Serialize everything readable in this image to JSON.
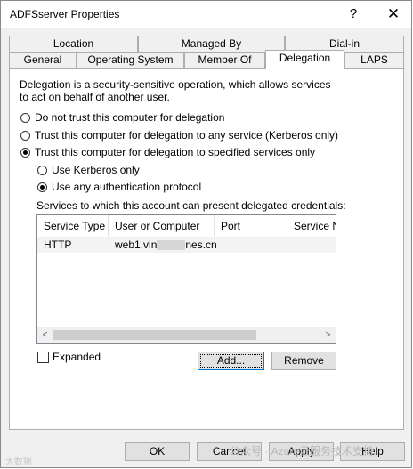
{
  "window": {
    "title": "ADFSserver Properties",
    "help_glyph": "?",
    "close_glyph": "✕"
  },
  "tabs_back": [
    {
      "label": "Location"
    },
    {
      "label": "Managed By"
    },
    {
      "label": "Dial-in"
    }
  ],
  "tabs_front": [
    {
      "label": "General"
    },
    {
      "label": "Operating System"
    },
    {
      "label": "Member Of"
    },
    {
      "label": "Delegation",
      "active": true
    },
    {
      "label": "LAPS"
    }
  ],
  "delegation": {
    "description": "Delegation is a security-sensitive operation, which allows services to act on behalf of another user.",
    "options": [
      {
        "label": "Do not trust this computer for delegation",
        "selected": false
      },
      {
        "label": "Trust this computer for delegation to any service (Kerberos only)",
        "selected": false
      },
      {
        "label": "Trust this computer for delegation to specified services only",
        "selected": true
      }
    ],
    "sub_options": [
      {
        "label": "Use Kerberos only",
        "selected": false
      },
      {
        "label": "Use any authentication protocol",
        "selected": true
      }
    ],
    "services_label": "Services to which this account can present delegated credentials:",
    "columns": [
      "Service Type",
      "User or Computer",
      "Port",
      "Service Na"
    ],
    "rows": [
      {
        "service_type": "HTTP",
        "host_prefix": "web1.vin",
        "host_suffix": "nes.cn",
        "port": "",
        "service_name": ""
      }
    ],
    "scroll_left": "<",
    "scroll_right": ">",
    "expanded_label": "Expanded",
    "add_label": "Add...",
    "remove_label": "Remove"
  },
  "footer": {
    "ok_label": "OK",
    "cancel_label": "Cancel",
    "apply_label": "Apply",
    "help_label": "Help"
  },
  "watermark": {
    "text": "公众号 · Azure云服务技术支持",
    "corner": "大数据"
  }
}
